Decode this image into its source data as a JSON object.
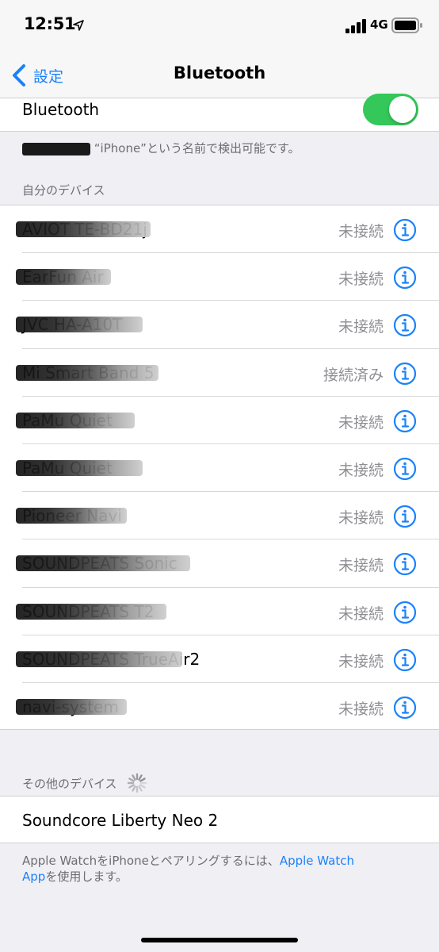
{
  "status_bar": {
    "time": "12:51",
    "network": "4G"
  },
  "nav": {
    "back_label": "設定",
    "title": "Bluetooth"
  },
  "bluetooth": {
    "label": "Bluetooth",
    "enabled": true
  },
  "discoverable_note": "“iPhone”という名前で検出可能です。",
  "my_devices": {
    "header": "自分のデバイス",
    "items": [
      {
        "name": "AVIOT TE-BD21j",
        "status": "未接続"
      },
      {
        "name": "EarFun Air",
        "status": "未接続"
      },
      {
        "name": "JVC HA-A10T",
        "status": "未接続"
      },
      {
        "name": "Mi Smart Band 5",
        "status": "接続済み"
      },
      {
        "name": "PaMu Quiet",
        "status": "未接続"
      },
      {
        "name": "PaMu Quiet",
        "status": "未接続"
      },
      {
        "name": "Pioneer Navi",
        "status": "未接続"
      },
      {
        "name": "SOUNDPEATS Sonic",
        "status": "未接続"
      },
      {
        "name": "SOUNDPEATS T2",
        "status": "未接続"
      },
      {
        "name": "SOUNDPEATS TrueAir2",
        "status": "未接続"
      },
      {
        "name": "navi-system",
        "status": "未接続"
      }
    ]
  },
  "other_devices": {
    "header": "その他のデバイス",
    "items": [
      {
        "name": "Soundcore Liberty Neo 2"
      }
    ]
  },
  "watch_note": {
    "text_before": "Apple WatchをiPhoneとペアリングするには、",
    "link1": "Apple Watch",
    "link2": "App",
    "text_after": "を使用します。"
  },
  "colors": {
    "accent": "#1a82fb",
    "toggle_on": "#34c759",
    "secondary_text": "#8e8e93"
  }
}
